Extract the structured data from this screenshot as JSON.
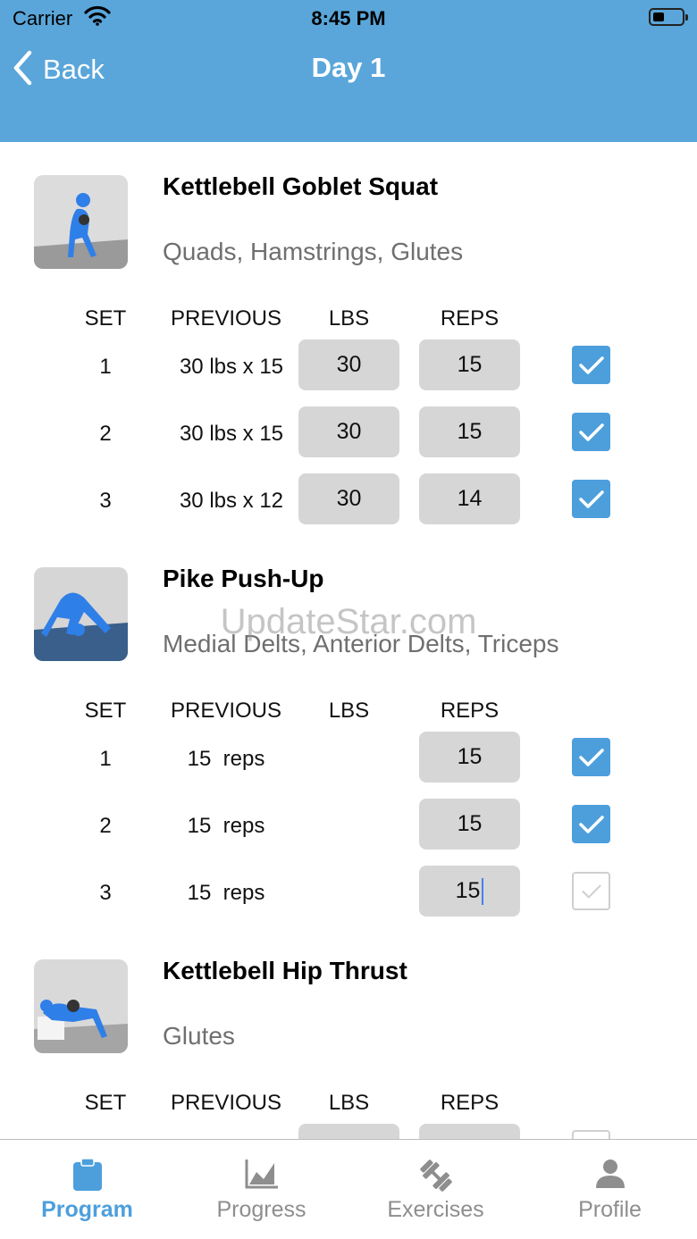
{
  "status_bar": {
    "carrier": "Carrier",
    "time": "8:45 PM"
  },
  "nav": {
    "back_label": "Back",
    "title": "Day 1"
  },
  "columns": {
    "set": "SET",
    "previous": "PREVIOUS",
    "lbs": "LBS",
    "reps": "REPS"
  },
  "exercises": [
    {
      "name": "Kettlebell Goblet Squat",
      "muscles": "Quads, Hamstrings, Glutes",
      "sets": [
        {
          "set": "1",
          "previous": "30 lbs x 15",
          "lbs": "30",
          "reps": "15",
          "done": true
        },
        {
          "set": "2",
          "previous": "30 lbs x 15",
          "lbs": "30",
          "reps": "15",
          "done": true
        },
        {
          "set": "3",
          "previous": "30 lbs x 12",
          "lbs": "30",
          "reps": "14",
          "done": true
        }
      ]
    },
    {
      "name": "Pike Push-Up",
      "muscles": "Medial Delts, Anterior Delts, Triceps",
      "sets": [
        {
          "set": "1",
          "previous": "15  reps",
          "reps": "15",
          "done": true
        },
        {
          "set": "2",
          "previous": "15  reps",
          "reps": "15",
          "done": true
        },
        {
          "set": "3",
          "previous": "15  reps",
          "reps": "15",
          "done": false
        }
      ]
    },
    {
      "name": "Kettlebell Hip Thrust",
      "muscles": "Glutes",
      "sets": []
    }
  ],
  "watermark": "UpdateStar.com",
  "tabs": [
    {
      "label": "Program",
      "icon": "clipboard-icon",
      "active": true
    },
    {
      "label": "Progress",
      "icon": "chart-icon",
      "active": false
    },
    {
      "label": "Exercises",
      "icon": "dumbbell-icon",
      "active": false
    },
    {
      "label": "Profile",
      "icon": "person-icon",
      "active": false
    }
  ],
  "colors": {
    "accent": "#5aa6da",
    "check": "#4d9fdc",
    "input_bg": "#d6d6d6",
    "muted": "#8e8e8e"
  }
}
